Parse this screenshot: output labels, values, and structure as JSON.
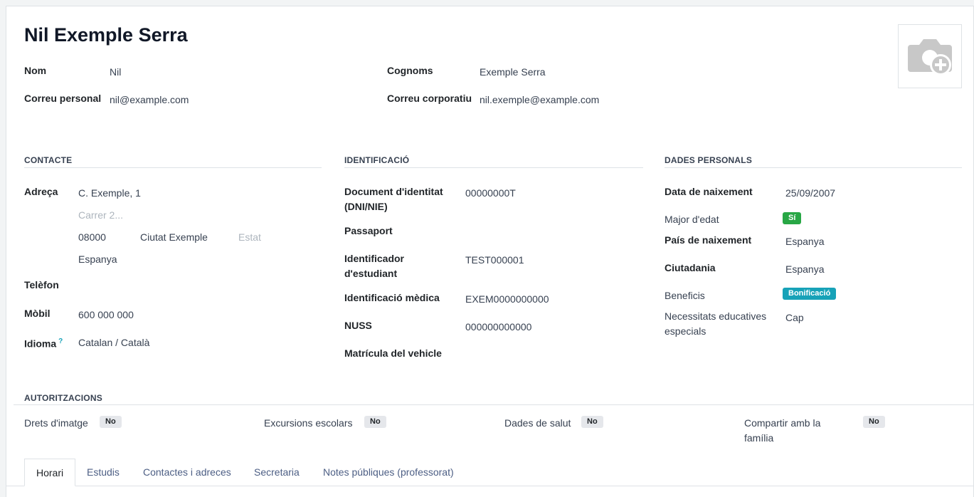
{
  "record": {
    "title": "Nil Exemple Serra",
    "fields": {
      "nom_label": "Nom",
      "nom_value": "Nil",
      "cognoms_label": "Cognoms",
      "cognoms_value": "Exemple Serra",
      "correu_personal_label": "Correu personal",
      "correu_personal_value": "nil@example.com",
      "correu_corporatiu_label": "Correu corporatiu",
      "correu_corporatiu_value": "nil.exemple@example.com"
    }
  },
  "contacte": {
    "header": "CONTACTE",
    "adreca_label": "Adreça",
    "street": "C. Exemple, 1",
    "street2_placeholder": "Carrer 2...",
    "zip": "08000",
    "city": "Ciutat Exemple",
    "state_placeholder": "Estat",
    "country": "Espanya",
    "telefon_label": "Telèfon",
    "mobil_label": "Mòbil",
    "mobil_value": "600 000 000",
    "idioma_label": "Idioma",
    "idioma_help": "?",
    "idioma_value": "Catalan / Català"
  },
  "identificacio": {
    "header": "IDENTIFICACIÓ",
    "doc_label_1": "Document d'identitat",
    "doc_label_2": "(DNI/NIE)",
    "doc_value": "00000000T",
    "passaport_label": "Passaport",
    "student_id_label_1": "Identificador",
    "student_id_label_2": "d'estudiant",
    "student_id_value": "TEST000001",
    "medical_label": "Identificació mèdica",
    "medical_value": "EXEM0000000000",
    "nuss_label": "NUSS",
    "nuss_value": "000000000000",
    "vehicle_label": "Matrícula del vehicle"
  },
  "dades_personals": {
    "header": "DADES PERSONALS",
    "naixement_label": "Data de naixement",
    "naixement_value": "25/09/2007",
    "major_label": "Major d'edat",
    "major_badge": "Sí",
    "pais_label": "País de naixement",
    "pais_value": "Espanya",
    "ciutadania_label": "Ciutadania",
    "ciutadania_value": "Espanya",
    "beneficis_label": "Beneficis",
    "beneficis_badge": "Bonificació",
    "nee_label_1": "Necessitats educatives",
    "nee_label_2": "especials",
    "nee_value": "Cap"
  },
  "autoritzacions": {
    "header": "AUTORITZACIONS",
    "drets_label": "Drets d'imatge",
    "drets_value": "No",
    "excursions_label": "Excursions escolars",
    "excursions_value": "No",
    "salut_label": "Dades de salut",
    "salut_value": "No",
    "familia_label_1": "Compartir amb la",
    "familia_label_2": "família",
    "familia_value": "No"
  },
  "tabs": [
    "Horari",
    "Estudis",
    "Contactes i adreces",
    "Secretaria",
    "Notes públiques (professorat)"
  ],
  "icons": {
    "avatar": "camera-plus-icon"
  },
  "colors": {
    "badge_green": "#28a745",
    "badge_teal": "#17a2b8",
    "tab_link": "#4c5e84"
  }
}
